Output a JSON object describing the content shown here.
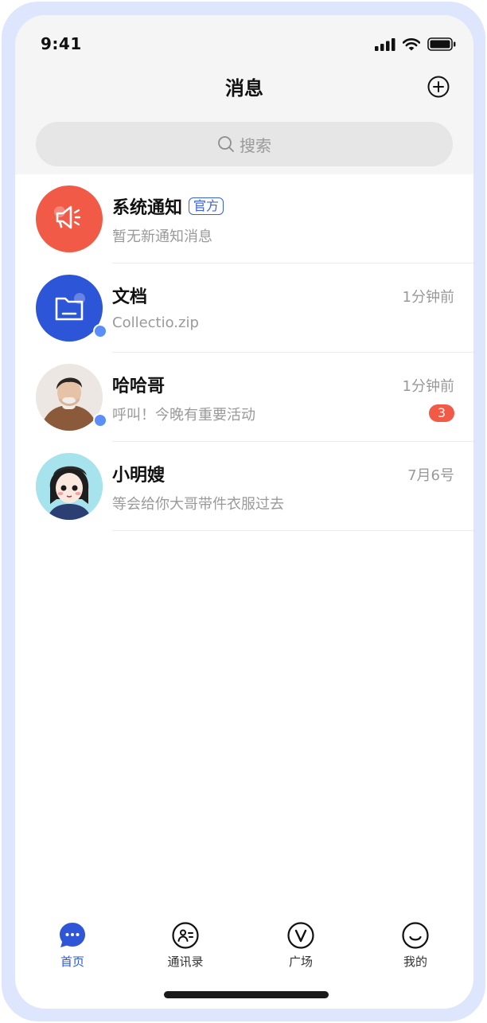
{
  "status_bar": {
    "time": "9:41"
  },
  "header": {
    "title": "消息"
  },
  "search": {
    "placeholder": "搜索"
  },
  "conversations": [
    {
      "name": "系统通知",
      "tag": "官方",
      "preview": "暂无新通知消息",
      "time": "",
      "unread": ""
    },
    {
      "name": "文档",
      "tag": "",
      "preview": "Collectio.zip",
      "time": "1分钟前",
      "unread": ""
    },
    {
      "name": "哈哈哥",
      "tag": "",
      "preview": "呼叫！今晚有重要活动",
      "time": "1分钟前",
      "unread": "3"
    },
    {
      "name": "小明嫂",
      "tag": "",
      "preview": "等会给你大哥带件衣服过去",
      "time": "7月6号",
      "unread": ""
    }
  ],
  "tabbar": {
    "items": [
      {
        "label": "首页",
        "icon": "chat-bubble-icon",
        "active": true
      },
      {
        "label": "通讯录",
        "icon": "contacts-icon",
        "active": false
      },
      {
        "label": "广场",
        "icon": "plaza-v-icon",
        "active": false
      },
      {
        "label": "我的",
        "icon": "smile-icon",
        "active": false
      }
    ]
  },
  "colors": {
    "accent": "#2f56d6",
    "notice_avatar": "#f25a48",
    "doc_avatar": "#2d55d8",
    "online_dot": "#5b8dfb",
    "unread_badge": "#f25a48",
    "frame": "#dde6fd"
  }
}
